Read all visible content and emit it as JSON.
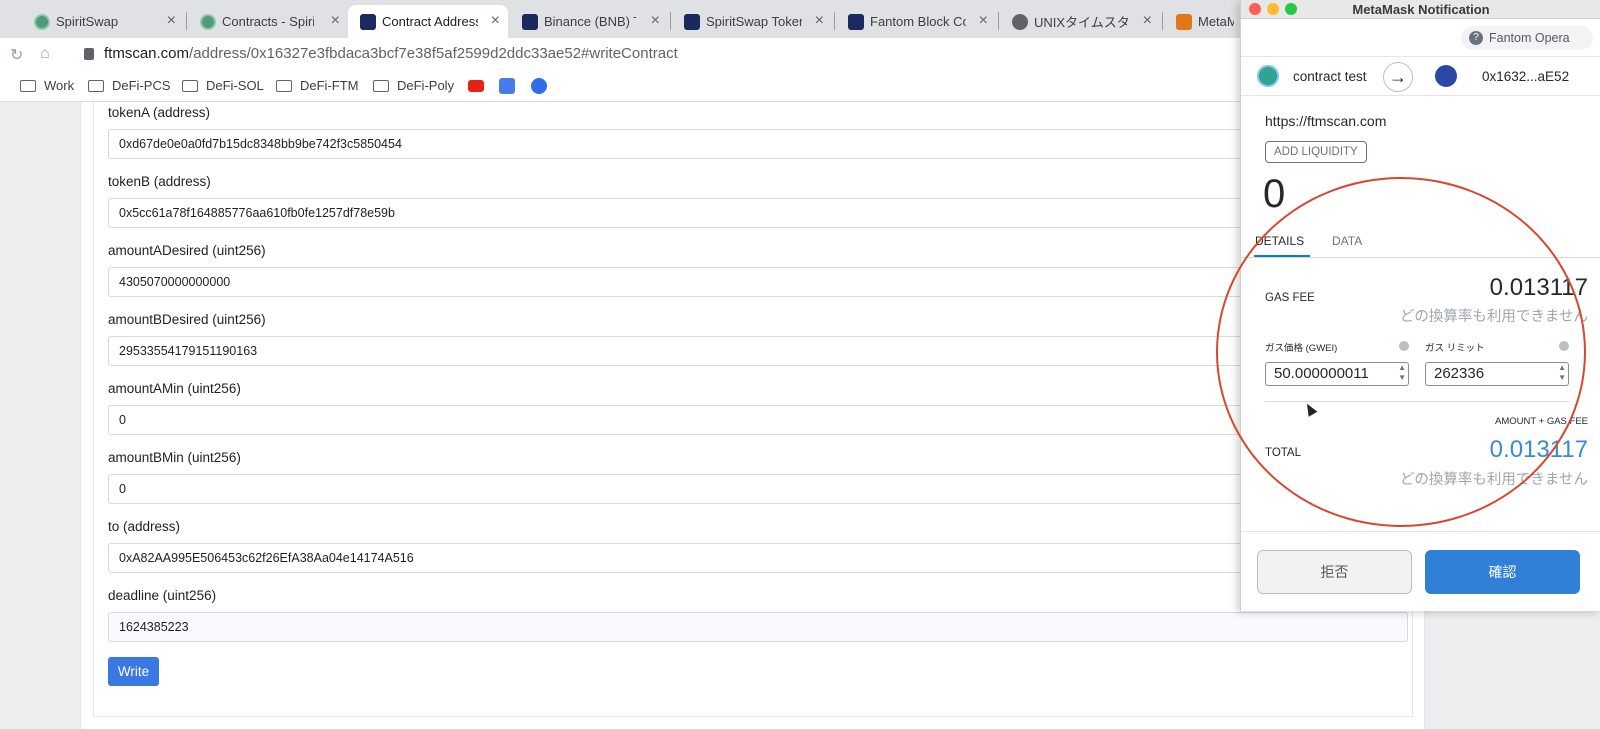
{
  "tabs": [
    {
      "title": "SpiritSwap",
      "icon": "spirit-icon"
    },
    {
      "title": "Contracts - Spirit",
      "icon": "spirit-icon"
    },
    {
      "title": "Contract Address",
      "icon": "ftmscan-icon",
      "active": true
    },
    {
      "title": "Binance (BNB) To",
      "icon": "ftmscan-icon"
    },
    {
      "title": "SpiritSwap Token",
      "icon": "ftmscan-icon"
    },
    {
      "title": "Fantom Block Co",
      "icon": "ftmscan-icon"
    },
    {
      "title": "UNIXタイムスタン",
      "icon": "globe-icon"
    },
    {
      "title": "MetaMas",
      "icon": "metamask-icon"
    }
  ],
  "address_bar": {
    "domain": "ftmscan.com",
    "path": "/address/0x16327e3fbdaca3bcf7e38f5af2599d2ddc33ae52#writeContract"
  },
  "bookmarks": [
    {
      "label": "Work"
    },
    {
      "label": "DeFi-PCS"
    },
    {
      "label": "DeFi-SOL"
    },
    {
      "label": "DeFi-FTM"
    },
    {
      "label": "DeFi-Poly"
    }
  ],
  "form": {
    "fields": [
      {
        "label": "tokenA (address)",
        "value": "0xd67de0e0a0fd7b15dc8348bb9be742f3c5850454"
      },
      {
        "label": "tokenB (address)",
        "value": "0x5cc61a78f164885776aa610fb0fe1257df78e59b"
      },
      {
        "label": "amountADesired (uint256)",
        "value": "4305070000000000"
      },
      {
        "label": "amountBDesired (uint256)",
        "value": "29533554179151190163"
      },
      {
        "label": "amountAMin (uint256)",
        "value": "0"
      },
      {
        "label": "amountBMin (uint256)",
        "value": "0"
      },
      {
        "label": "to (address)",
        "value": "0xA82AA995E506453c62f26EfA38Aa04e14174A516"
      },
      {
        "label": "deadline (uint256)",
        "value": "1624385223"
      }
    ],
    "write_label": "Write"
  },
  "metamask": {
    "window_title": "MetaMask Notification",
    "network": "Fantom Opera",
    "from_account": "contract test",
    "to_account": "0x1632...aE52",
    "origin": "https://ftmscan.com",
    "method": "ADD LIQUIDITY",
    "amount": "0",
    "tabs": [
      "DETAILS",
      "DATA"
    ],
    "gas_fee_label": "GAS FEE",
    "gas_fee_value": "0.013117",
    "gas_fee_note": "どの換算率も利用できません",
    "gas_price_label": "ガス価格 (GWEI)",
    "gas_price_value": "50.000000011",
    "gas_limit_label": "ガス リミット",
    "gas_limit_value": "262336",
    "amount_gas_label": "AMOUNT + GAS FEE",
    "total_label": "TOTAL",
    "total_value": "0.013117",
    "total_note": "どの換算率も利用できません",
    "reject_label": "拒否",
    "confirm_label": "確認"
  },
  "colors": {
    "accent": "#3a78e3",
    "metamask_blue": "#2f80d6",
    "annotation": "#d9462e"
  }
}
